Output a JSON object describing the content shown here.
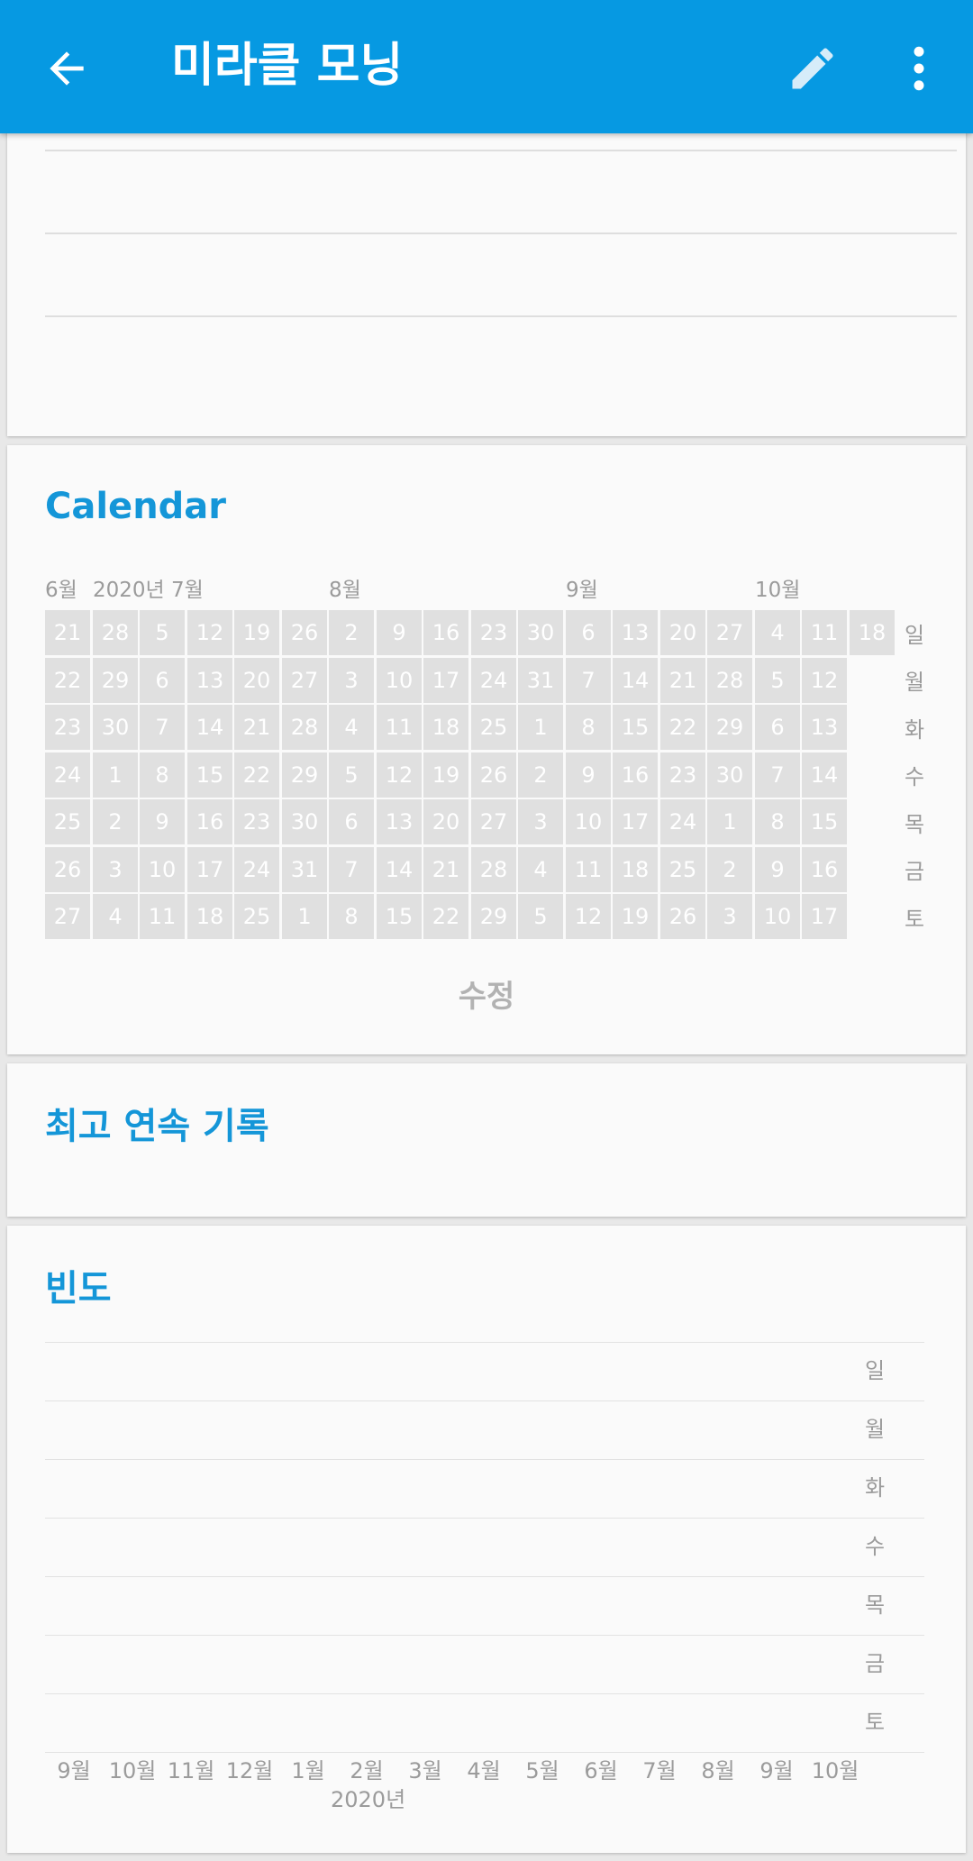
{
  "appbar": {
    "title": "미라클 모닝",
    "back_icon": "arrow-back-icon",
    "edit_icon": "pencil-icon",
    "more_icon": "more-vert-icon",
    "color": "#0699e2"
  },
  "calendar": {
    "title": "Calendar",
    "month_labels": [
      "6월",
      "7월",
      "8월",
      "9월",
      "10월"
    ],
    "year_label": "2020년",
    "weekdays": [
      "일",
      "월",
      "화",
      "수",
      "목",
      "금",
      "토"
    ],
    "weeks": [
      [
        "21",
        "22",
        "23",
        "24",
        "25",
        "26",
        "27"
      ],
      [
        "28",
        "29",
        "30",
        "1",
        "2",
        "3",
        "4"
      ],
      [
        "5",
        "6",
        "7",
        "8",
        "9",
        "10",
        "11"
      ],
      [
        "12",
        "13",
        "14",
        "15",
        "16",
        "17",
        "18"
      ],
      [
        "19",
        "20",
        "21",
        "22",
        "23",
        "24",
        "25"
      ],
      [
        "26",
        "27",
        "28",
        "29",
        "30",
        "31",
        "1"
      ],
      [
        "2",
        "3",
        "4",
        "5",
        "6",
        "7",
        "8"
      ],
      [
        "9",
        "10",
        "11",
        "12",
        "13",
        "14",
        "15"
      ],
      [
        "16",
        "17",
        "18",
        "19",
        "20",
        "21",
        "22"
      ],
      [
        "23",
        "24",
        "25",
        "26",
        "27",
        "28",
        "29"
      ],
      [
        "30",
        "31",
        "1",
        "2",
        "3",
        "4",
        "5"
      ],
      [
        "6",
        "7",
        "8",
        "9",
        "10",
        "11",
        "12"
      ],
      [
        "13",
        "14",
        "15",
        "16",
        "17",
        "18",
        "19"
      ],
      [
        "20",
        "21",
        "22",
        "23",
        "24",
        "25",
        "26"
      ],
      [
        "27",
        "28",
        "29",
        "30",
        "1",
        "2",
        "3"
      ],
      [
        "4",
        "5",
        "6",
        "7",
        "8",
        "9",
        "10"
      ],
      [
        "11",
        "12",
        "13",
        "14",
        "15",
        "16",
        "17"
      ],
      [
        "18"
      ]
    ],
    "edit_label": "수정",
    "title_color": "#1496d8",
    "cell_color": "#e0e0e0"
  },
  "streak": {
    "title": "최고 연속 기록"
  },
  "frequency": {
    "title": "빈도",
    "weekdays": [
      "일",
      "월",
      "화",
      "수",
      "목",
      "금",
      "토"
    ],
    "months": [
      "9월",
      "10월",
      "11월",
      "12월",
      "1월",
      "2월",
      "3월",
      "4월",
      "5월",
      "6월",
      "7월",
      "8월",
      "9월",
      "10월"
    ],
    "year_label": "2020년"
  }
}
